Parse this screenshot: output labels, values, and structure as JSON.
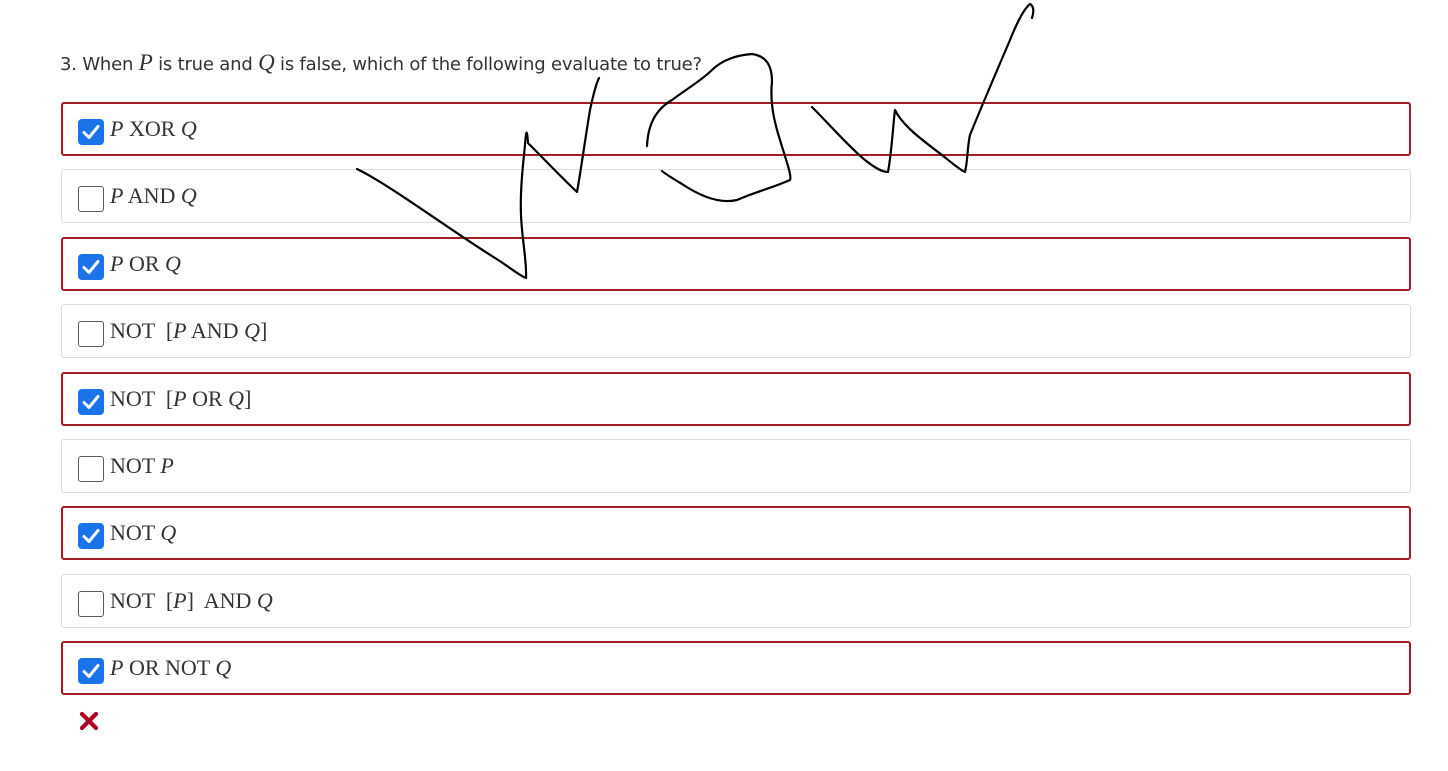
{
  "question": {
    "number": "3.",
    "text_1": "When",
    "var_p": "P",
    "text_2": "is true and",
    "var_q": "Q",
    "text_3": "is false, which of the following evaluate to true?"
  },
  "options": [
    {
      "label": "P XOR Q",
      "checked": true
    },
    {
      "label": "P AND Q",
      "checked": false
    },
    {
      "label": "P OR Q",
      "checked": true
    },
    {
      "label": "NOT  [P AND Q]",
      "checked": false
    },
    {
      "label": "NOT  [P OR Q]",
      "checked": true
    },
    {
      "label": "NOT P",
      "checked": false
    },
    {
      "label": "NOT Q",
      "checked": true
    },
    {
      "label": "NOT  [P]  AND Q",
      "checked": false
    },
    {
      "label": "P OR NOT Q",
      "checked": true
    }
  ],
  "result": {
    "icon": "incorrect-x-icon",
    "color": "#b00020"
  },
  "colors": {
    "accent_border": "#a51c24",
    "checkbox_checked": "#1a73e8"
  }
}
